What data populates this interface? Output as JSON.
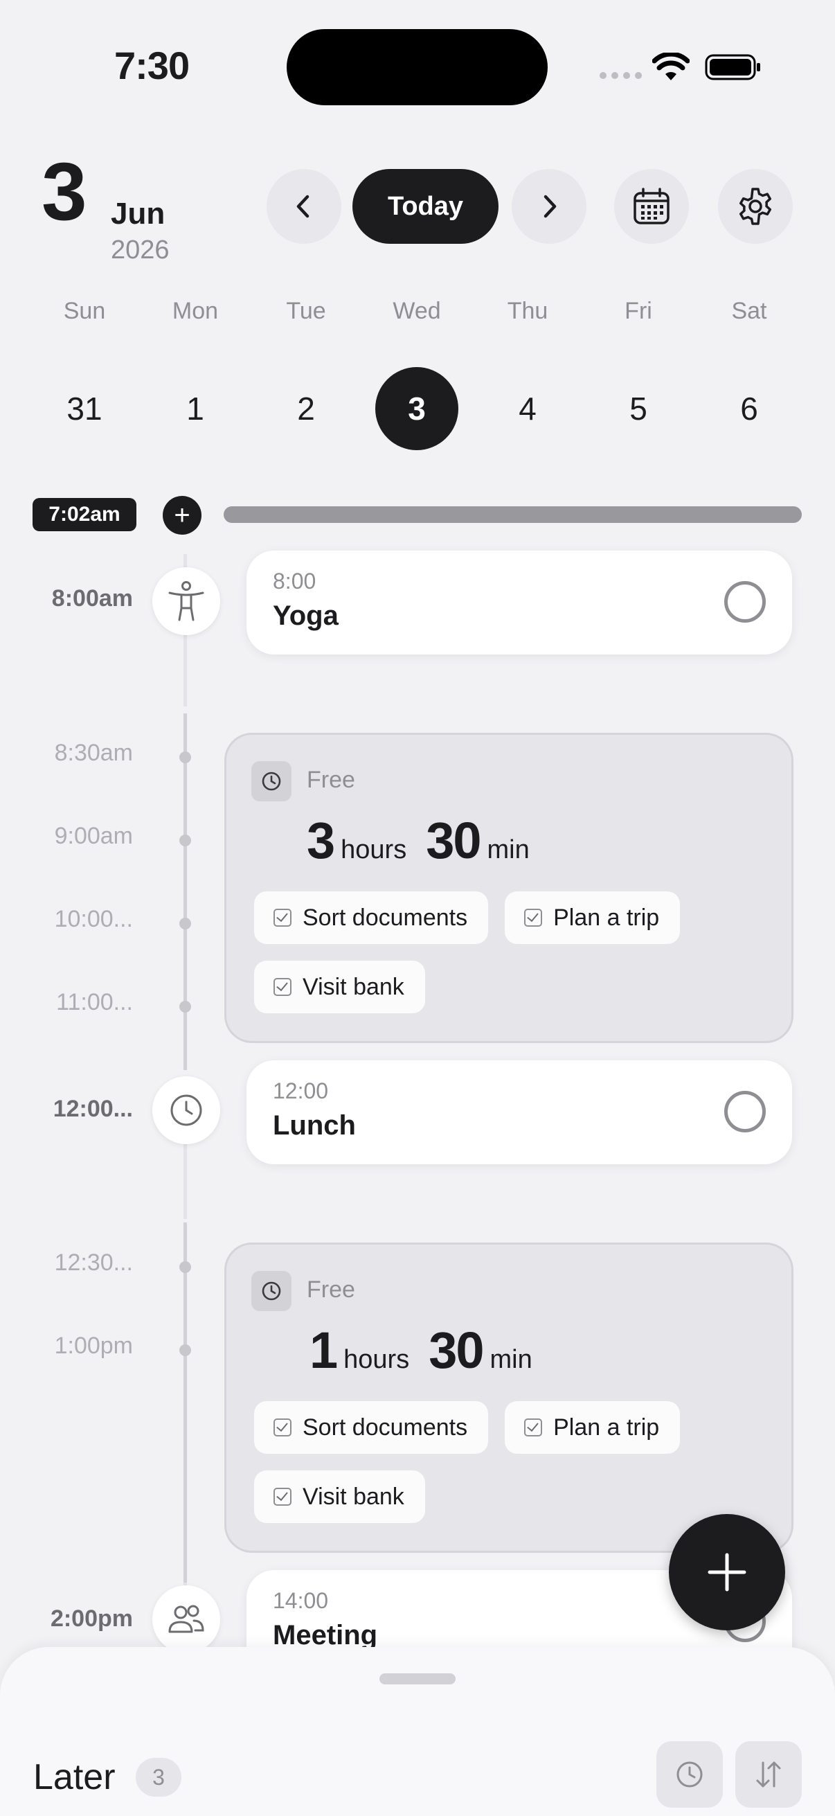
{
  "status_bar": {
    "time": "7:30",
    "icons": [
      "signal-icon",
      "wifi-icon",
      "battery-icon"
    ]
  },
  "header": {
    "day": "3",
    "month": "Jun",
    "year": "2026",
    "today_label": "Today",
    "icons": [
      "chevron-left-icon",
      "chevron-right-icon",
      "calendar-icon",
      "gear-icon"
    ]
  },
  "week": {
    "days": [
      {
        "name": "Sun",
        "num": "31",
        "selected": false
      },
      {
        "name": "Mon",
        "num": "1",
        "selected": false
      },
      {
        "name": "Tue",
        "num": "2",
        "selected": false
      },
      {
        "name": "Wed",
        "num": "3",
        "selected": true
      },
      {
        "name": "Thu",
        "num": "4",
        "selected": false
      },
      {
        "name": "Fri",
        "num": "5",
        "selected": false
      },
      {
        "name": "Sat",
        "num": "6",
        "selected": false
      }
    ]
  },
  "now": {
    "label": "7:02am"
  },
  "timeline": {
    "labels": {
      "t800": "8:00am",
      "t830": "8:30am",
      "t900": "9:00am",
      "t1000": "10:00...",
      "t1100": "11:00...",
      "t1200": "12:00...",
      "t1230": "12:30...",
      "t1300": "1:00pm",
      "t1400": "2:00pm"
    },
    "events": {
      "yoga": {
        "time": "8:00",
        "title": "Yoga",
        "icon": "person-icon"
      },
      "lunch": {
        "time": "12:00",
        "title": "Lunch",
        "icon": "clock-icon"
      },
      "meeting": {
        "time": "14:00",
        "title": "Meeting",
        "icon": "people-icon"
      }
    },
    "free1": {
      "label": "Free",
      "hours": "3",
      "hours_unit": "hours",
      "minutes": "30",
      "minutes_unit": "min",
      "tasks": [
        "Sort documents",
        "Plan a trip",
        "Visit bank"
      ]
    },
    "free2": {
      "label": "Free",
      "hours": "1",
      "hours_unit": "hours",
      "minutes": "30",
      "minutes_unit": "min",
      "tasks": [
        "Sort documents",
        "Plan a trip",
        "Visit bank"
      ]
    }
  },
  "later": {
    "title": "Later",
    "count": "3",
    "icons": [
      "clock-icon",
      "sort-icon"
    ]
  },
  "colors": {
    "accent": "#1c1c1e",
    "background": "#f2f2f5",
    "free_card": "#e6e6ea"
  }
}
